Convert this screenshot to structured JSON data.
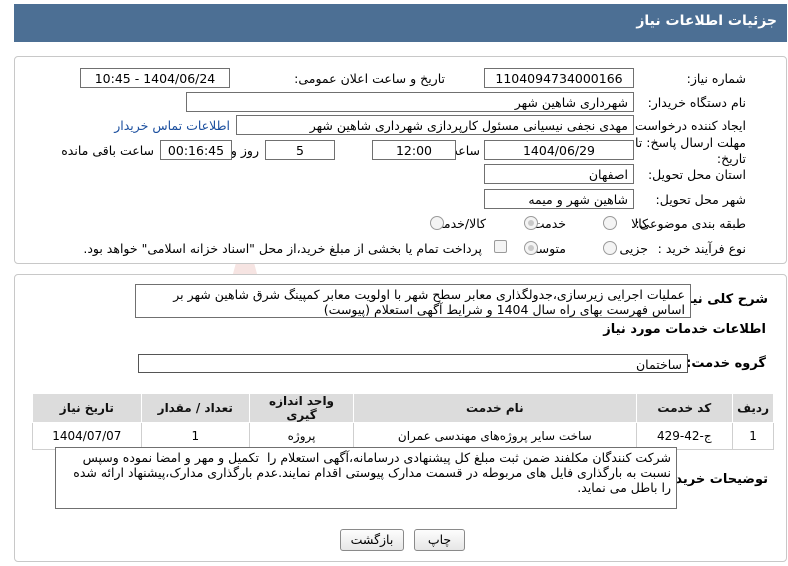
{
  "header": {
    "title": "جزئیات اطلاعات نیاز"
  },
  "need_info": {
    "need_number_label": "شماره نیاز:",
    "need_number": "1104094734000166",
    "announce_label": "تاریخ و ساعت اعلان عمومی:",
    "announce_value": "1404/06/24 - 10:45",
    "buyer_org_label": "نام دستگاه خریدار:",
    "buyer_org": "شهرداری شاهین شهر",
    "creator_label": "ایجاد کننده درخواست:",
    "creator": "مهدی نجفی نیسیانی مسئول کارپردازی شهرداری شاهین شهر",
    "contact_link": "اطلاعات تماس خریدار",
    "deadline_label_line1": "مهلت ارسال پاسخ: تا",
    "deadline_label_line2": "تاریخ:",
    "deadline_date": "1404/06/29",
    "time_label": "ساعت",
    "deadline_time": "12:00",
    "days_value": "5",
    "days_label": "روز و",
    "remaining_time": "00:16:45",
    "remaining_label": "ساعت باقی مانده",
    "province_label": "استان محل تحویل:",
    "province": "اصفهان",
    "city_label": "شهر محل تحویل:",
    "city": "شاهین شهر و میمه",
    "category_label": "طبقه بندی موضوعی:",
    "category_options": [
      "کالا",
      "خدمت",
      "کالا/خدمت"
    ],
    "category_selected": "خدمت",
    "process_label": "نوع فرآیند خرید :",
    "process_options": [
      "جزیی",
      "متوسط"
    ],
    "process_selected": "متوسط",
    "payment_note": "پرداخت تمام یا بخشی از مبلغ خرید،از محل \"اسناد خزانه اسلامی\" خواهد بود."
  },
  "summary": {
    "label": "شرح کلی نیاز:",
    "text": "عملیات اجرایی زیرسازی،جدولگذاری معابر سطح شهر با اولویت معابر کمپینگ شرق شاهین شهر بر اساس فهرست بهای راه سال 1404 و شرایط آگهی استعلام (پیوست)"
  },
  "services": {
    "section_title": "اطلاعات خدمات مورد نیاز",
    "group_label": "گروه خدمت:",
    "group_value": "ساختمان",
    "columns": [
      "ردیف",
      "کد خدمت",
      "نام خدمت",
      "واحد اندازه گیری",
      "تعداد / مقدار",
      "تاریخ نیاز"
    ],
    "rows": [
      [
        "1",
        "ج-42-429",
        "ساخت سایر پروژه‌های مهندسی عمران",
        "پروژه",
        "1",
        "1404/07/07"
      ]
    ]
  },
  "buyer_notes": {
    "label": "توضیحات خریدار:",
    "text": "شرکت کنندگان مکلفند ضمن ثبت مبلغ کل پیشنهادی درسامانه،آگهی استعلام را  تکمیل و مهر و امضا نموده وسپس نسبت به بارگذاری فایل های مربوطه در قسمت مدارک پیوستی اقدام نمایند.عدم بارگذاری مدارک،پیشنهاد ارائه شده را باطل می نماید."
  },
  "buttons": {
    "print": "چاپ",
    "back": "بازگشت"
  },
  "colors": {
    "header_bg": "#4c6f94",
    "link": "#1a4e9e",
    "watermark": "#d9534f"
  }
}
